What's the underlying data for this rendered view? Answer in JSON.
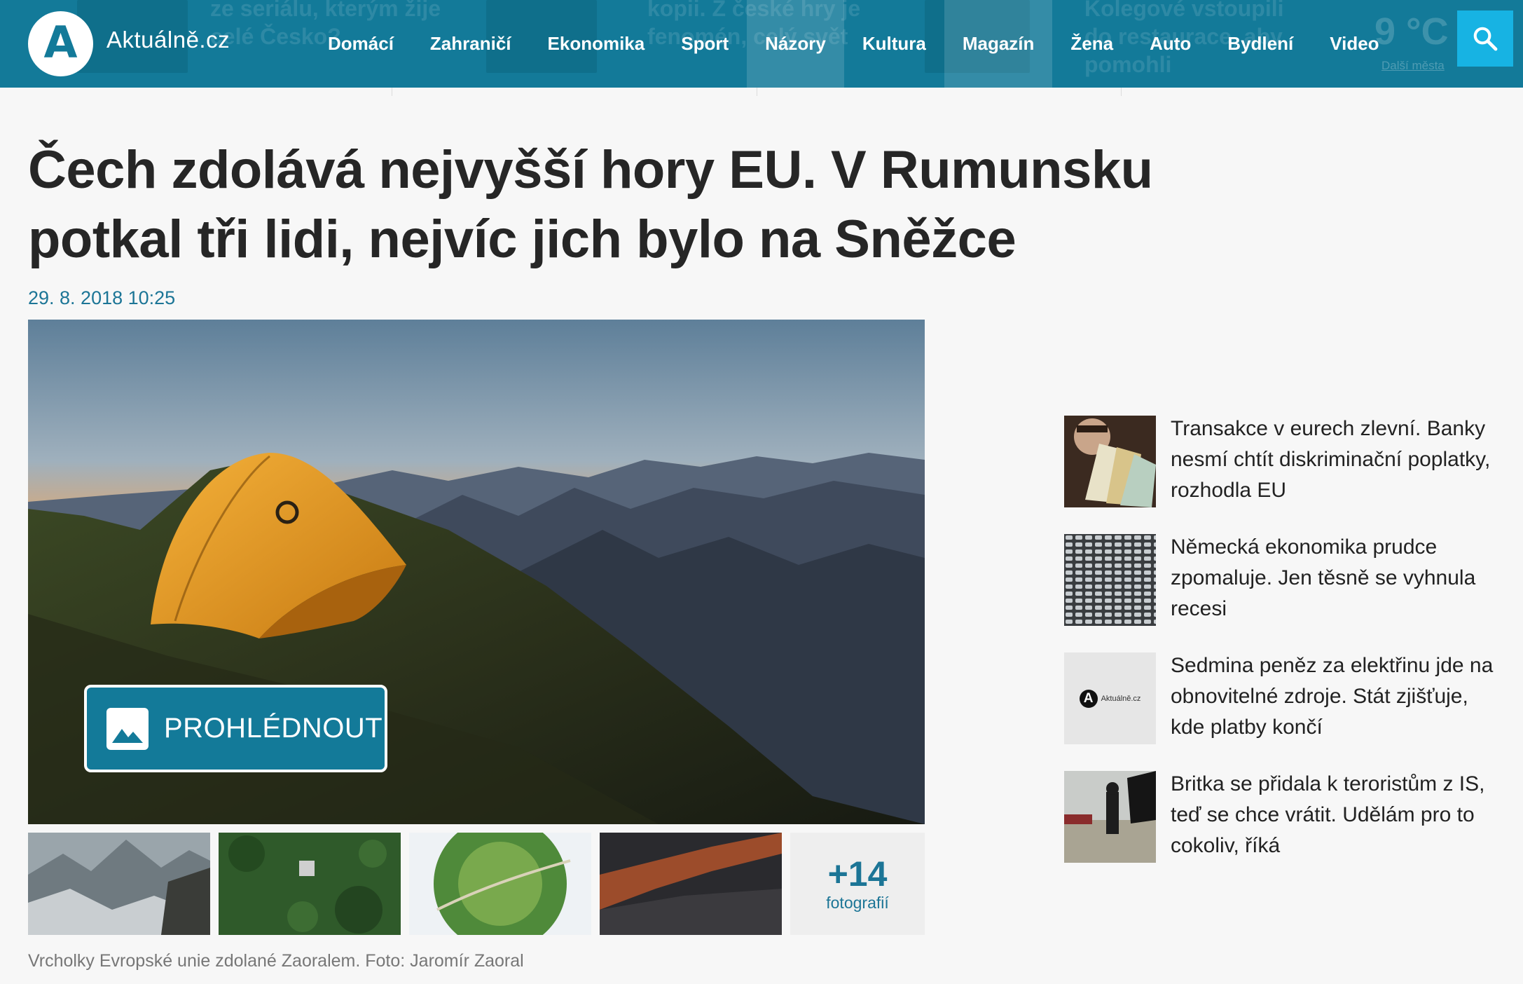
{
  "header": {
    "site_name": "Aktuálně.cz",
    "logo_letter": "A",
    "nav": [
      {
        "label": "Domácí",
        "highlight": false
      },
      {
        "label": "Zahraničí",
        "highlight": false
      },
      {
        "label": "Ekonomika",
        "highlight": false
      },
      {
        "label": "Sport",
        "highlight": false
      },
      {
        "label": "Názory",
        "highlight": true
      },
      {
        "label": "Kultura",
        "highlight": false
      },
      {
        "label": "Magazín",
        "highlight": true
      },
      {
        "label": "Žena",
        "highlight": false
      },
      {
        "label": "Auto",
        "highlight": false
      },
      {
        "label": "Bydlení",
        "highlight": false
      },
      {
        "label": "Video",
        "highlight": false
      }
    ],
    "search_icon": "search-icon",
    "background_teasers": [
      "ze seriálu, kterým žije celé Česko?",
      "kopii. Z české hry je fenomén, celý svět",
      "Kolegové vstoupili do restaurace, aby pomohli"
    ],
    "weather_value": "9 °C",
    "weather_link": "Další města"
  },
  "article": {
    "headline": "Čech zdolává nejvyšší hory EU. V Rumunsku potkal tři lidi, nejvíc jich bylo na Sněžce",
    "date": "29. 8. 2018 10:25",
    "gallery_button": "PROHLÉDNOUT",
    "gallery_icon": "image-icon",
    "more_count": "+14",
    "more_label": "fotografií",
    "caption": "Vrcholky Evropské unie zdolané Zaoralem. Foto: Jaromír Zaoral"
  },
  "sidebar": {
    "items": [
      {
        "title": "Transakce v eurech zlevní. Banky nesmí chtít diskriminační poplatky, rozhodla EU"
      },
      {
        "title": "Německá ekonomika prudce zpomaluje. Jen těsně se vyhnula recesi"
      },
      {
        "title": "Sedmina peněz za elektřinu jde na obnovitelné zdroje. Stát zjišťuje, kde platby končí",
        "logo_text": "Aktuálně.cz",
        "logo_letter": "A"
      },
      {
        "title": "Britka se přidala k teroristům z IS, teď se chce vrátit. Udělám pro to cokoliv, říká"
      }
    ]
  },
  "colors": {
    "header_bg": "#137a99",
    "accent": "#1c7596",
    "search_bg": "#17b3e3"
  }
}
